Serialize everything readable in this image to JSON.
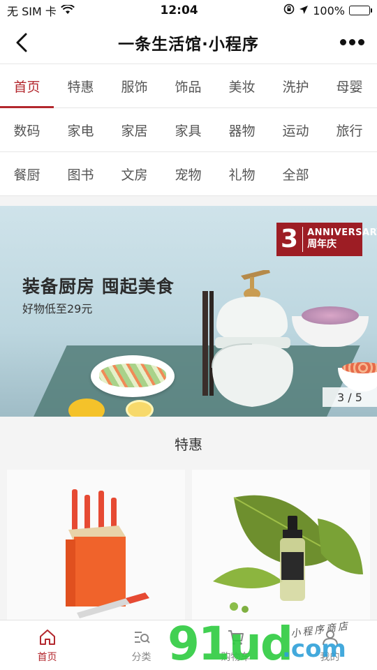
{
  "status_bar": {
    "carrier": "无 SIM 卡",
    "time": "12:04",
    "battery": "100%"
  },
  "navbar": {
    "title": "一条生活馆·小程序"
  },
  "categories": {
    "rows": [
      [
        "首页",
        "特惠",
        "服饰",
        "饰品",
        "美妆",
        "洗护",
        "母婴"
      ],
      [
        "数码",
        "家电",
        "家居",
        "家具",
        "器物",
        "运动",
        "旅行"
      ],
      [
        "餐厨",
        "图书",
        "文房",
        "宠物",
        "礼物",
        "全部"
      ]
    ],
    "active": "首页"
  },
  "banner": {
    "headline": "装备厨房 囤起美食",
    "subline": "好物低至29元",
    "badge_number": "3",
    "badge_en": "ANNIVERSARY",
    "badge_cn": "周年庆",
    "pager": "3 / 5"
  },
  "section": {
    "title": "特惠"
  },
  "products": [
    {
      "name": "knife-block-product"
    },
    {
      "name": "serum-bottle-product"
    }
  ],
  "tabbar": {
    "items": [
      {
        "label": "首页",
        "icon": "home-icon",
        "active": true
      },
      {
        "label": "分类",
        "icon": "category-search-icon",
        "active": false
      },
      {
        "label": "购物车",
        "icon": "cart-icon",
        "active": false
      },
      {
        "label": "我的",
        "icon": "user-icon",
        "active": false
      }
    ]
  },
  "watermark": {
    "big": "91ud",
    "domain": ".com",
    "tagline": "小程序商店"
  },
  "colors": {
    "accent": "#b3272d",
    "badge": "#9d1d24"
  }
}
